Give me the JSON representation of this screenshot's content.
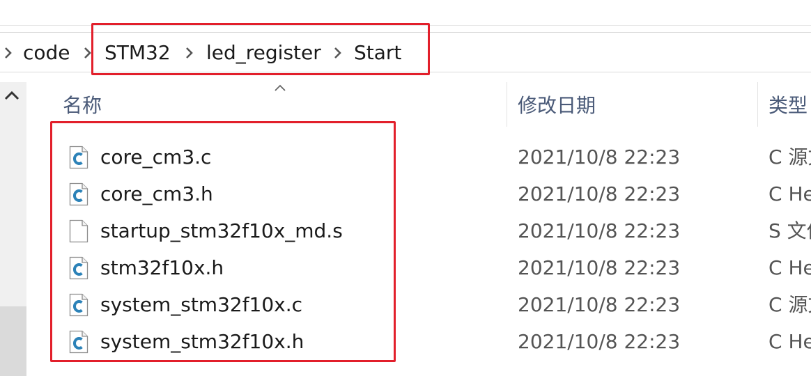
{
  "breadcrumb": {
    "segments": [
      "code",
      "STM32",
      "led_register",
      "Start"
    ]
  },
  "columns": {
    "name": "名称",
    "date": "修改日期",
    "type": "类型"
  },
  "files": [
    {
      "name": "core_cm3.c",
      "date": "2021/10/8 22:23",
      "type": "C 源文",
      "icon": "c-source-file-icon"
    },
    {
      "name": "core_cm3.h",
      "date": "2021/10/8 22:23",
      "type": "C Hea",
      "icon": "c-header-file-icon"
    },
    {
      "name": "startup_stm32f10x_md.s",
      "date": "2021/10/8 22:23",
      "type": "S 文件",
      "icon": "generic-file-icon"
    },
    {
      "name": "stm32f10x.h",
      "date": "2021/10/8 22:23",
      "type": "C Hea",
      "icon": "c-header-file-icon"
    },
    {
      "name": "system_stm32f10x.c",
      "date": "2021/10/8 22:23",
      "type": "C 源文",
      "icon": "c-source-file-icon"
    },
    {
      "name": "system_stm32f10x.h",
      "date": "2021/10/8 22:23",
      "type": "C Hea",
      "icon": "c-header-file-icon"
    }
  ],
  "colors": {
    "highlight_box": "#e21f2b",
    "c_icon": "#2c82b8"
  }
}
